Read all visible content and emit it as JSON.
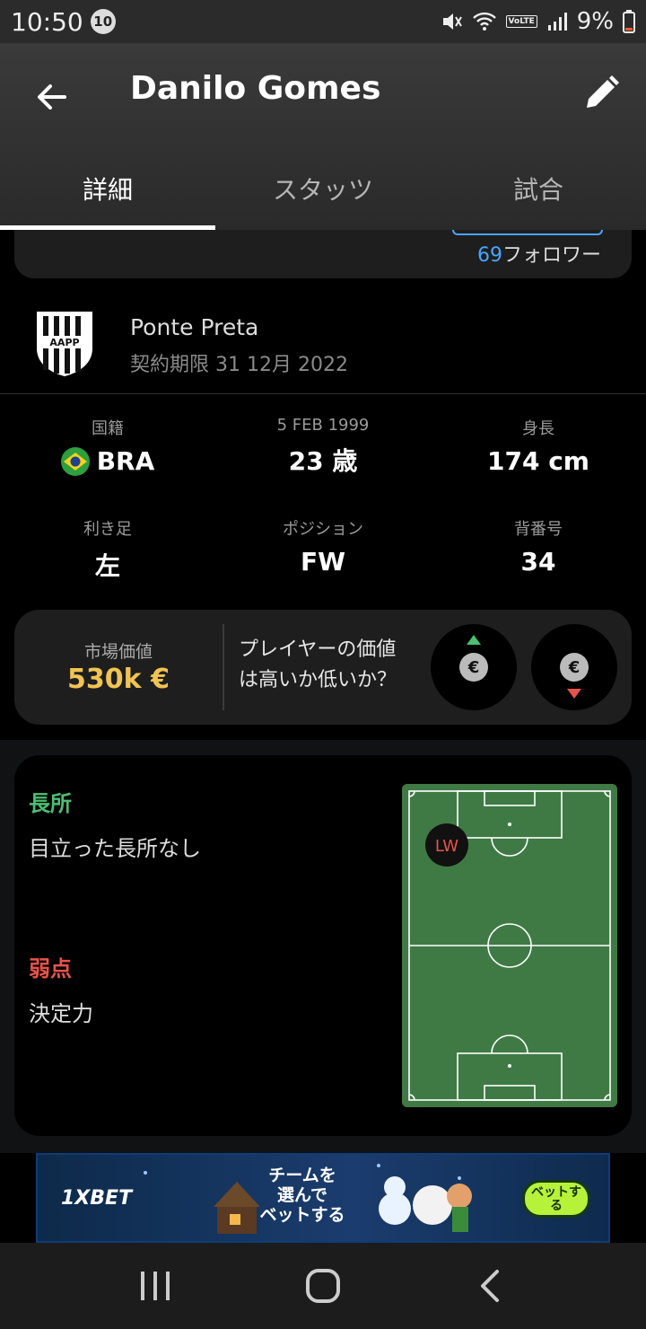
{
  "status_bar": {
    "time": "10:50",
    "notification_count": "10",
    "network_badge": "VoLTE",
    "battery": "9%"
  },
  "header": {
    "title": "Danilo Gomes"
  },
  "tabs": [
    {
      "label": "詳細",
      "active": true
    },
    {
      "label": "スタッツ",
      "active": false
    },
    {
      "label": "試合",
      "active": false
    }
  ],
  "followers": {
    "count": "69",
    "label": "フォロワー"
  },
  "club": {
    "name": "Ponte Preta",
    "contract": "契約期限 31 12月 2022",
    "logo_text": "AAPP"
  },
  "info": {
    "nationality": {
      "label": "国籍",
      "value": "BRA"
    },
    "birth": {
      "label": "5 FEB 1999",
      "value": "23 歳"
    },
    "height": {
      "label": "身長",
      "value": "174 cm"
    },
    "foot": {
      "label": "利き足",
      "value": "左"
    },
    "position": {
      "label": "ポジション",
      "value": "FW"
    },
    "number": {
      "label": "背番号",
      "value": "34"
    }
  },
  "market": {
    "label": "市場価値",
    "value": "530k €",
    "question_line1": "プレイヤーの価値",
    "question_line2": "は高いか低いか？",
    "coin_symbol": "€"
  },
  "strengths": {
    "strengths_title": "長所",
    "strengths_text": "目立った長所なし",
    "weaknesses_title": "弱点",
    "weaknesses_text": "決定力",
    "position_marker": "LW"
  },
  "ad": {
    "brand": "1XBET",
    "copy_line1": "チームを",
    "copy_line2": "選んで",
    "copy_line3": "ベットする",
    "cta_line1": "ベットす",
    "cta_line2": "る"
  },
  "colors": {
    "accent_blue": "#4aa3ff",
    "market_value": "#f0c452",
    "strength_green": "#4bbf73",
    "weakness_red": "#e8534a",
    "pitch_green": "#3f7a45"
  }
}
